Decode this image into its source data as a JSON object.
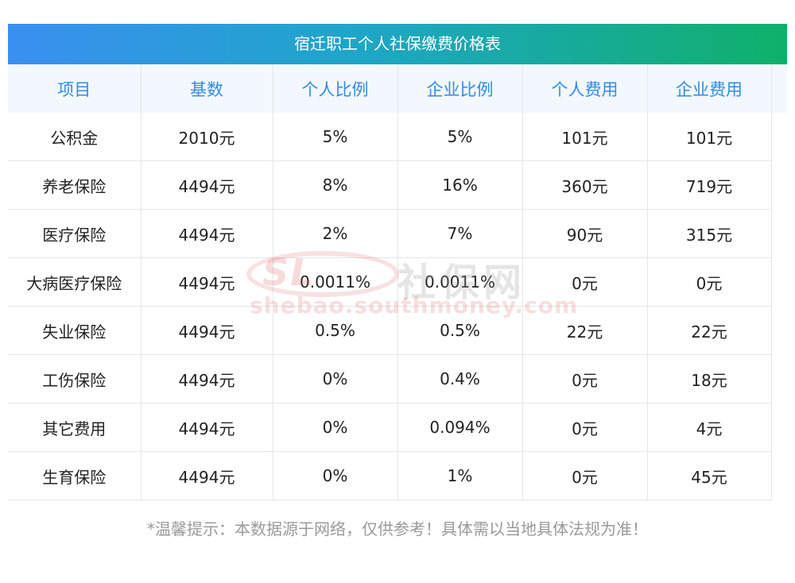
{
  "title": "宿迁职工个人社保缴费价格表",
  "table": {
    "headers": [
      "项目",
      "基数",
      "个人比例",
      "企业比例",
      "个人费用",
      "企业费用"
    ],
    "rows": [
      [
        "公积金",
        "2010元",
        "5%",
        "5%",
        "101元",
        "101元"
      ],
      [
        "养老保险",
        "4494元",
        "8%",
        "16%",
        "360元",
        "719元"
      ],
      [
        "医疗保险",
        "4494元",
        "2%",
        "7%",
        "90元",
        "315元"
      ],
      [
        "大病医疗保险",
        "4494元",
        "0.0011%",
        "0.0011%",
        "0元",
        "0元"
      ],
      [
        "失业保险",
        "4494元",
        "0.5%",
        "0.5%",
        "22元",
        "22元"
      ],
      [
        "工伤保险",
        "4494元",
        "0%",
        "0.4%",
        "0元",
        "18元"
      ],
      [
        "其它费用",
        "4494元",
        "0%",
        "0.094%",
        "0元",
        "4元"
      ],
      [
        "生育保险",
        "4494元",
        "0%",
        "1%",
        "0元",
        "45元"
      ]
    ]
  },
  "watermark": {
    "logo": "SL",
    "name": "社保网",
    "url": "shebao.southmoney.com"
  },
  "note": "*温馨提示：本数据源于网络，仅供参考！具体需以当地具体法规为准！"
}
